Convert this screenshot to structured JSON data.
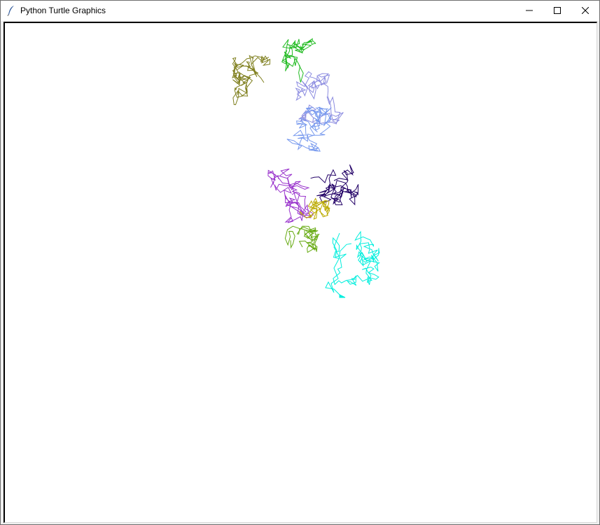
{
  "window": {
    "title": "Python Turtle Graphics",
    "app_icon": "feather-icon",
    "controls": {
      "minimize_icon": "minimize-icon",
      "maximize_icon": "maximize-icon",
      "close_icon": "close-icon"
    }
  },
  "canvas": {
    "background": "#ffffff",
    "drawing": "random-walk turtle trails",
    "trail_colors": [
      "#808020",
      "#22bb22",
      "#8c8ce0",
      "#7799ee",
      "#9933cc",
      "#220066",
      "#bbaa00",
      "#66aa11",
      "#00eedd"
    ],
    "turtle_color": "#00eedd"
  }
}
